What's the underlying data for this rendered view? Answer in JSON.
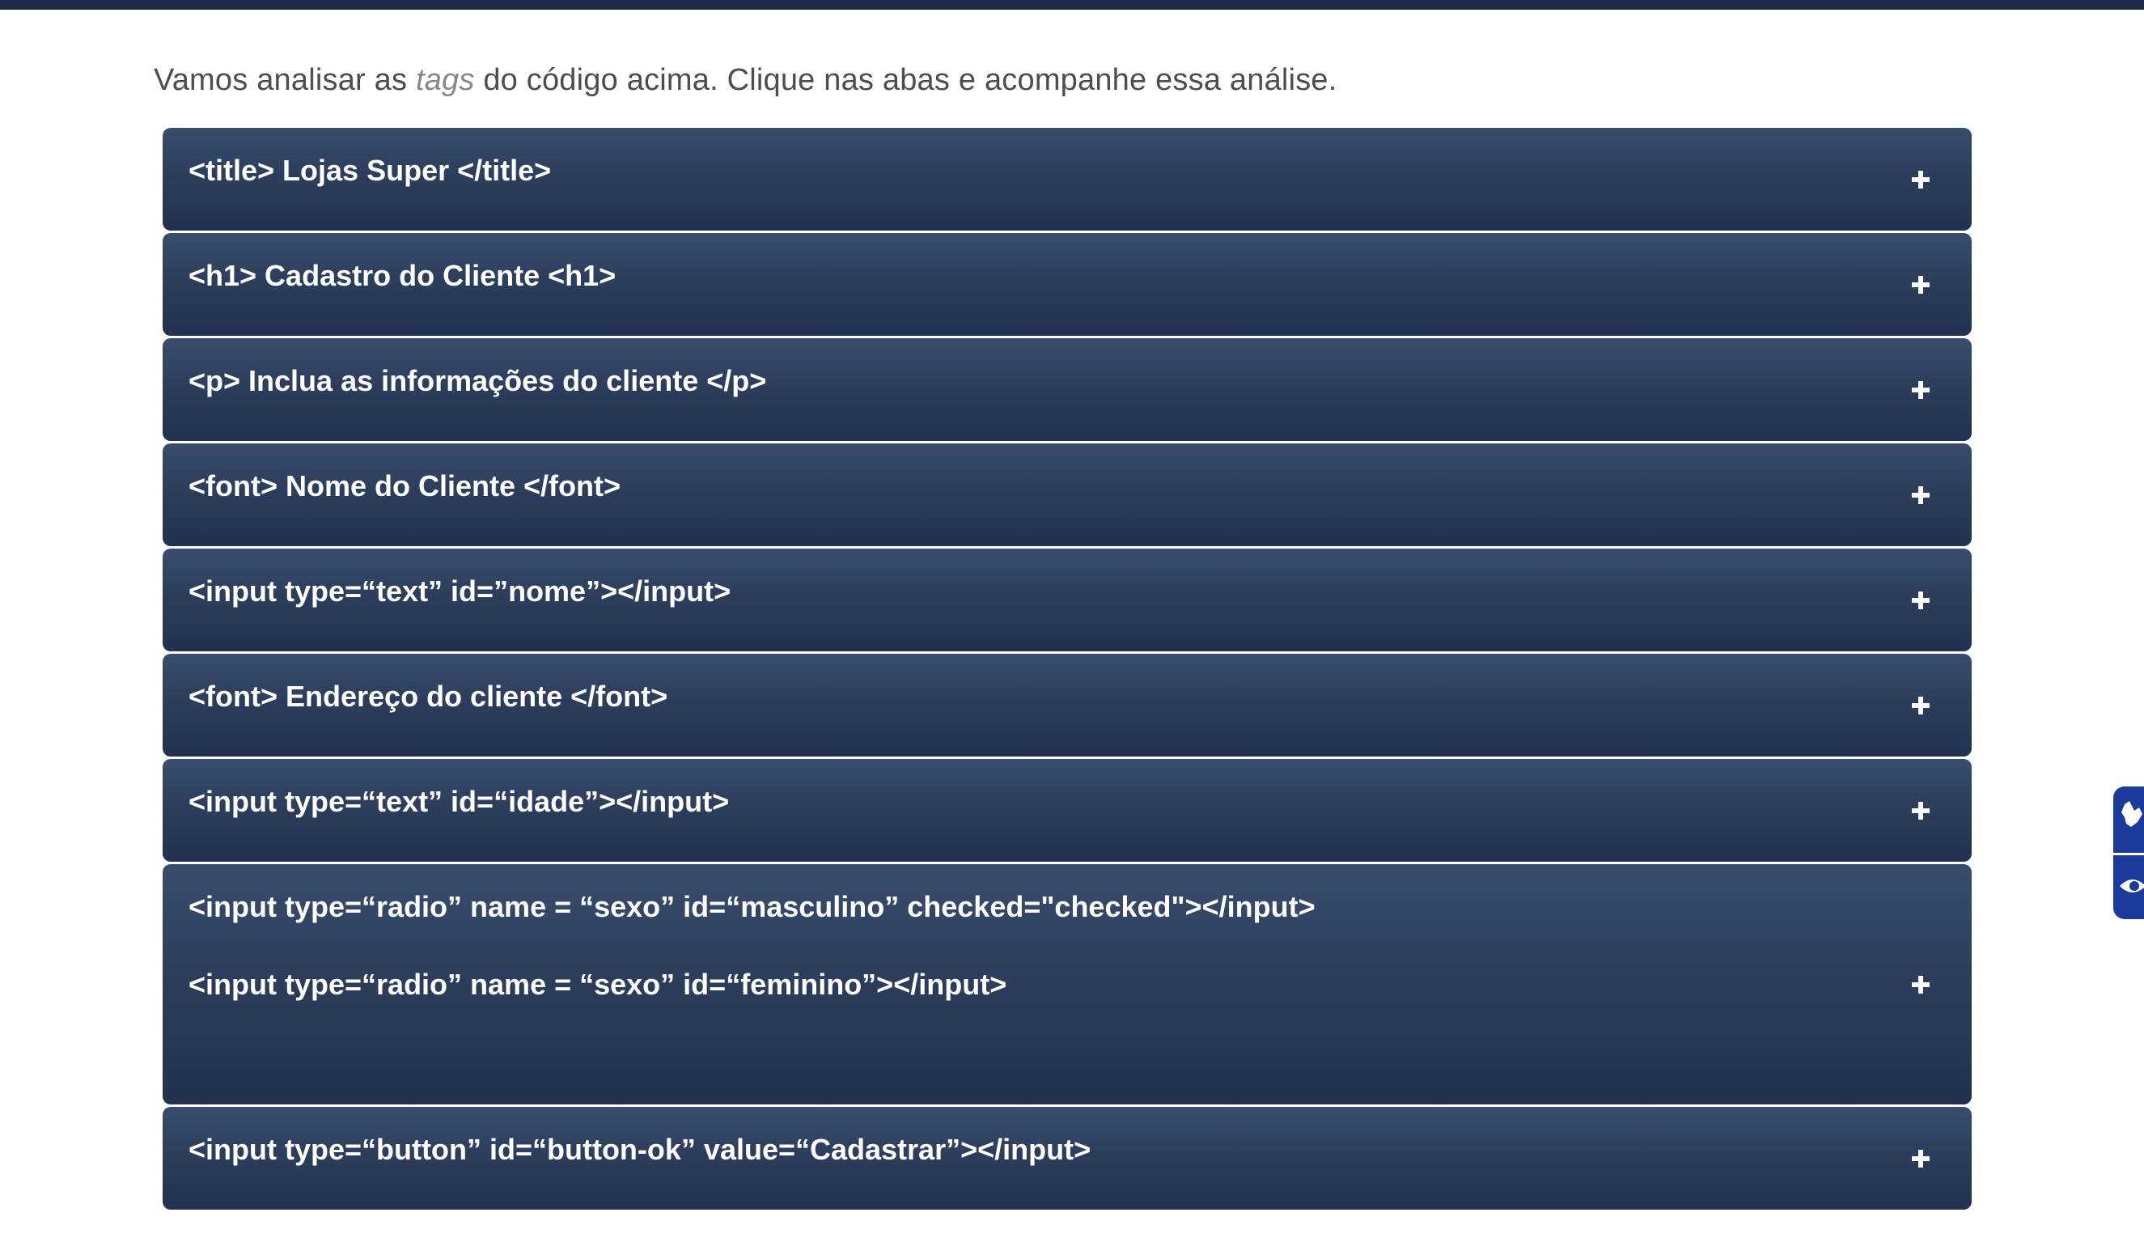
{
  "intro": {
    "before": "Vamos analisar as",
    "emphasis": "tags",
    "after": "do código acima. Clique nas abas e acompanhe essa análise."
  },
  "accordion": {
    "items": [
      {
        "title": "<title> Lojas Super </title>"
      },
      {
        "title": "<h1> Cadastro do Cliente <h1>"
      },
      {
        "title": "<p> Inclua as informações do cliente </p>"
      },
      {
        "title": "<font> Nome do Cliente </font>"
      },
      {
        "title": "<input type=“text” id=”nome”></input>"
      },
      {
        "title": "<font> Endereço do cliente </font>"
      },
      {
        "title": "<input type=“text” id=“idade”></input>"
      },
      {
        "title": "<input type=“radio” name = “sexo” id=“masculino” checked=\"checked\"></input>",
        "line2": "<input type=“radio” name = “sexo” id=“feminino”></input>"
      },
      {
        "title": "<input type=“button” id=“button-ok” value=“Cadastrar”></input>"
      }
    ],
    "expand_icon": "plus-icon"
  },
  "accessibility": {
    "buttons": [
      "sign-language-hand-icon",
      "eye-icon"
    ],
    "color": "#1a3a9c"
  },
  "colors": {
    "header_bar": "#1e2a47",
    "accordion_bg": "#2d3e5c",
    "accordion_text": "#ffffff",
    "intro_text": "#4d4d4d"
  }
}
